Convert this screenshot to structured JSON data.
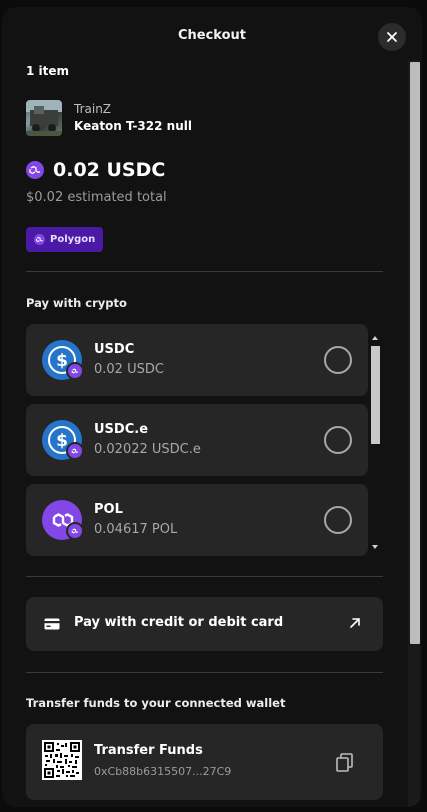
{
  "header": {
    "title": "Checkout"
  },
  "order": {
    "item_count": "1 item",
    "collection": "TrainZ",
    "item_name": "Keaton T-322 null",
    "price": "0.02 USDC",
    "estimated_total": "$0.02 estimated total",
    "network": "Polygon"
  },
  "crypto": {
    "section_label": "Pay with crypto",
    "tokens": [
      {
        "name": "USDC",
        "amount": "0.02 USDC",
        "icon": "usdc-icon",
        "chain_icon": "polygon-icon"
      },
      {
        "name": "USDC.e",
        "amount": "0.02022 USDC.e",
        "icon": "usdc-icon",
        "chain_icon": "polygon-icon"
      },
      {
        "name": "POL",
        "amount": "0.04617 POL",
        "icon": "pol-icon",
        "chain_icon": "polygon-icon"
      }
    ]
  },
  "card": {
    "label": "Pay with credit or debit card",
    "icon": "credit-card-icon",
    "action_icon": "external-link-icon"
  },
  "transfer": {
    "section_label": "Transfer funds to your connected wallet",
    "title": "Transfer Funds",
    "address": "0xCb88b6315507...27C9",
    "icon": "qr-code-icon",
    "action_icon": "copy-icon"
  },
  "colors": {
    "accent": "#8247e5",
    "badge_bg": "#4a1aa6",
    "usdc": "#2775ca"
  }
}
